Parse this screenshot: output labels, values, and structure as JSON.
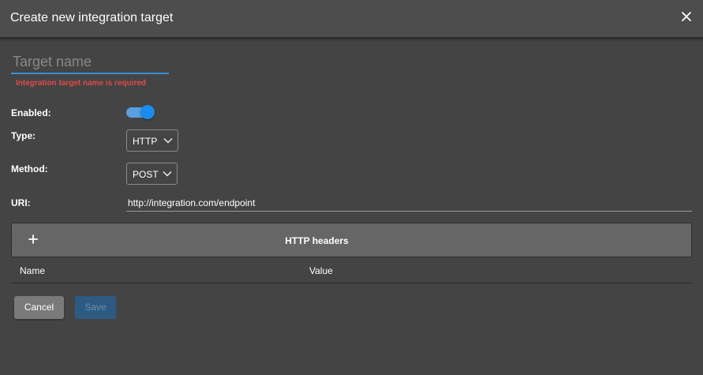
{
  "dialog": {
    "title": "Create new integration target",
    "close_icon": "close-icon"
  },
  "form": {
    "target_name": {
      "value": "",
      "placeholder": "Target name",
      "error": "Integration target name is required"
    },
    "enabled": {
      "label": "Enabled:",
      "checked": true
    },
    "type": {
      "label": "Type:",
      "selected": "HTTP"
    },
    "method": {
      "label": "Method:",
      "selected": "POST"
    },
    "uri": {
      "label": "URI:",
      "value": "http://integration.com/endpoint"
    }
  },
  "headers": {
    "add_icon": "plus-icon",
    "title": "HTTP headers",
    "columns": [
      "Name",
      "Value"
    ]
  },
  "actions": {
    "cancel_label": "Cancel",
    "save_label": "Save"
  },
  "colors": {
    "accent": "#3b8fd6",
    "error": "#e04a4a",
    "toggle_on": "#1a8cf0"
  }
}
